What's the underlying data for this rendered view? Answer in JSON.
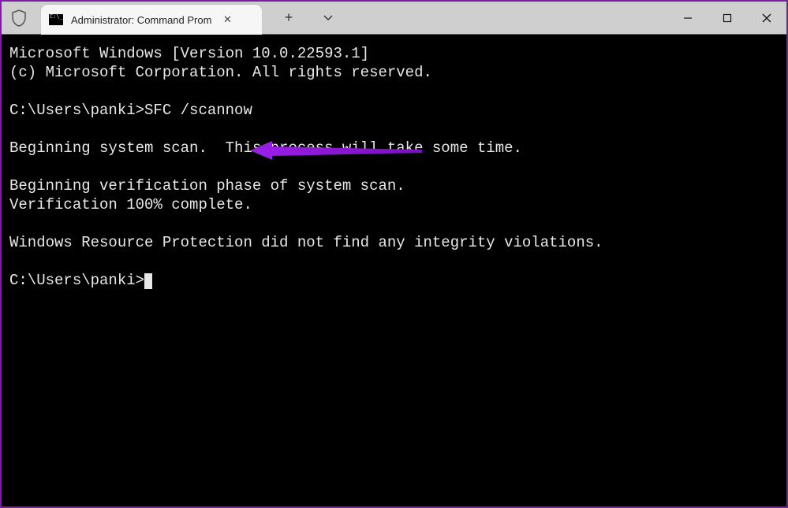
{
  "window": {
    "tab_title": "Administrator: Command Prom",
    "controls": {
      "new_tab": "+",
      "tab_dropdown": "⌄",
      "minimize": "—",
      "maximize": "□",
      "close": "✕",
      "tab_close": "✕"
    }
  },
  "terminal": {
    "line1": "Microsoft Windows [Version 10.0.22593.1]",
    "line2": "(c) Microsoft Corporation. All rights reserved.",
    "blank1": "",
    "prompt1": "C:\\Users\\panki>",
    "command1": "SFC /scannow",
    "blank2": "",
    "line3": "Beginning system scan.  This process will take some time.",
    "blank3": "",
    "line4": "Beginning verification phase of system scan.",
    "line5": "Verification 100% complete.",
    "blank4": "",
    "line6": "Windows Resource Protection did not find any integrity violations.",
    "blank5": "",
    "prompt2": "C:\\Users\\panki>"
  },
  "annotation": {
    "arrow_color": "#9b1fe8"
  }
}
